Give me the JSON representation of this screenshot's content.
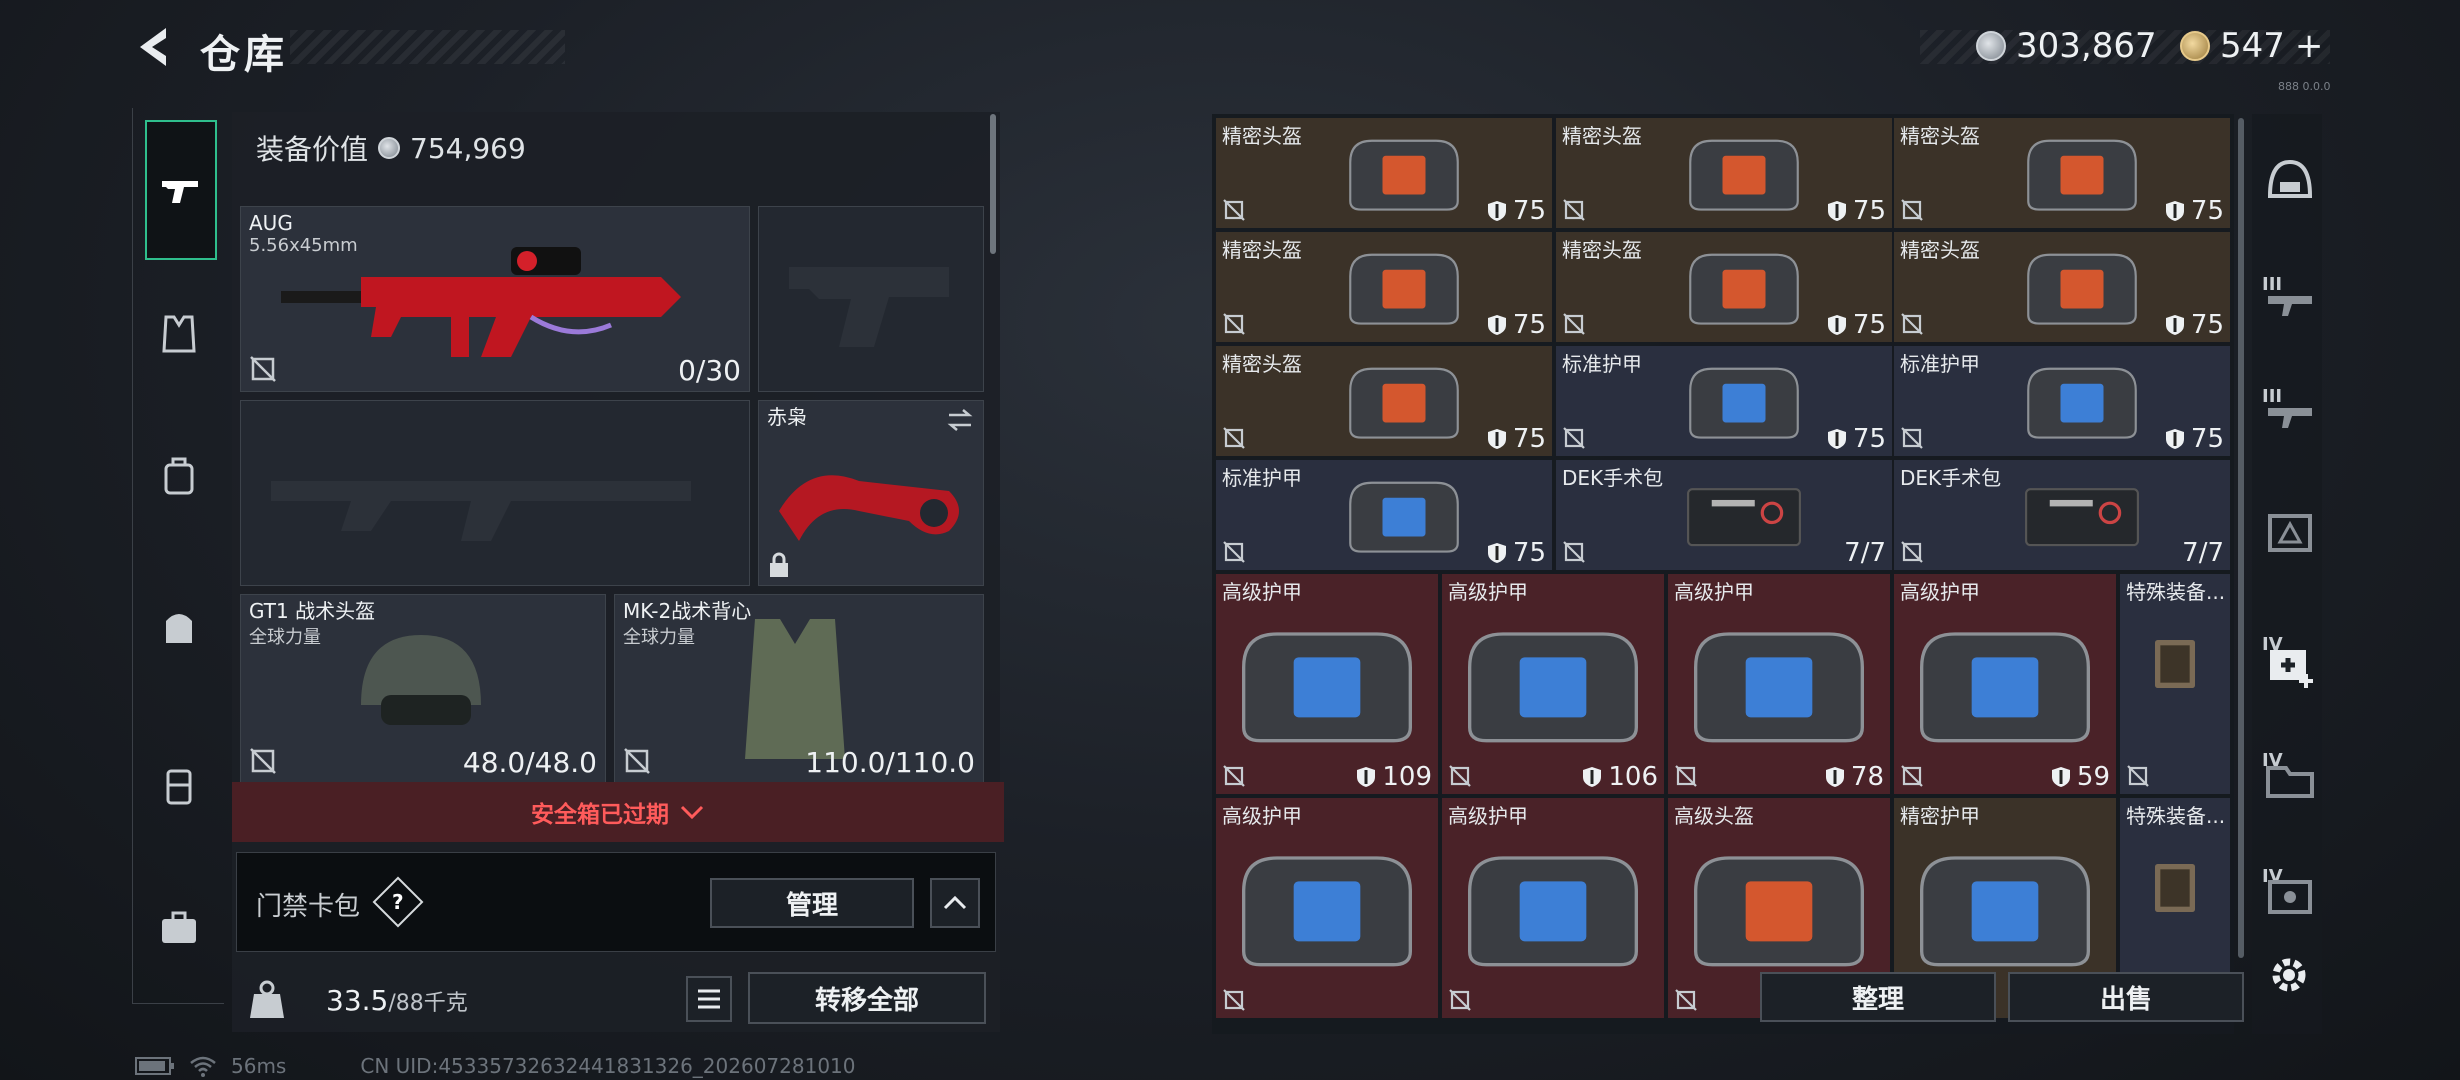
{
  "header": {
    "title": "仓库",
    "currency_silver": "303,867",
    "currency_gold": "547",
    "gold_plus": "+",
    "version": "888 0.0.0"
  },
  "equipment": {
    "value_label": "装备价值",
    "value": "754,969",
    "primary": {
      "name": "AUG",
      "ammo_type": "5.56x45mm",
      "ammo": "0/30"
    },
    "melee": {
      "name": "赤枭"
    },
    "helmet": {
      "name": "GT1 战术头盔",
      "brand": "全球力量",
      "durability": "48.0/48.0"
    },
    "vest": {
      "name": "MK-2战术背心",
      "brand": "全球力量",
      "durability": "110.0/110.0"
    },
    "safebox_status": "安全箱已过期",
    "keycard_label": "门禁卡包",
    "help_label": "?",
    "manage_label": "管理",
    "weight": "33.5",
    "weight_max": "/88千克",
    "transfer_all_label": "转移全部"
  },
  "storage": {
    "items": [
      {
        "name": "精密头盔",
        "val": "75",
        "type": "helmet",
        "bg": "brown"
      },
      {
        "name": "精密头盔",
        "val": "75",
        "type": "helmet",
        "bg": "brown"
      },
      {
        "name": "精密头盔",
        "val": "75",
        "type": "helmet",
        "bg": "brown"
      },
      {
        "name": "精密头盔",
        "val": "75",
        "type": "helmet",
        "bg": "brown"
      },
      {
        "name": "精密头盔",
        "val": "75",
        "type": "helmet",
        "bg": "brown"
      },
      {
        "name": "精密头盔",
        "val": "75",
        "type": "helmet",
        "bg": "brown"
      },
      {
        "name": "精密头盔",
        "val": "75",
        "type": "helmet",
        "bg": "brown"
      },
      {
        "name": "标准护甲",
        "val": "75",
        "type": "armor",
        "bg": "blue"
      },
      {
        "name": "标准护甲",
        "val": "75",
        "type": "armor",
        "bg": "blue"
      },
      {
        "name": "标准护甲",
        "val": "75",
        "type": "armor",
        "bg": "blue"
      },
      {
        "name": "DEK手术包",
        "val": "7/7",
        "type": "kit",
        "bg": "blue"
      },
      {
        "name": "DEK手术包",
        "val": "7/7",
        "type": "kit",
        "bg": "blue"
      },
      {
        "name": "高级护甲",
        "val": "109",
        "type": "armor",
        "bg": "red"
      },
      {
        "name": "高级护甲",
        "val": "106",
        "type": "armor",
        "bg": "red"
      },
      {
        "name": "高级护甲",
        "val": "78",
        "type": "armor",
        "bg": "red"
      },
      {
        "name": "高级护甲",
        "val": "59",
        "type": "armor",
        "bg": "red"
      },
      {
        "name": "特殊装备...",
        "val": "",
        "type": "special",
        "bg": "blue"
      },
      {
        "name": "高级护甲",
        "val": "",
        "type": "armor",
        "bg": "red"
      },
      {
        "name": "高级护甲",
        "val": "",
        "type": "armor",
        "bg": "red"
      },
      {
        "name": "高级头盔",
        "val": "",
        "type": "helmet",
        "bg": "red"
      },
      {
        "name": "精密护甲",
        "val": "",
        "type": "armor",
        "bg": "brown"
      },
      {
        "name": "特殊装备...",
        "val": "",
        "type": "special",
        "bg": "blue"
      }
    ],
    "sort_label": "整理",
    "sell_label": "出售"
  },
  "right_nav": {
    "tier_labels": [
      "III",
      "III",
      "IV",
      "IV",
      "IV"
    ]
  },
  "status": {
    "ping": "56ms",
    "uid": "CN UID:45335732632441831326_202607281010"
  },
  "colors": {
    "accent": "#2fbf8d",
    "expired": "#ff5b5b",
    "brown": "#3b3228",
    "blue": "#2a2f3f",
    "red": "#4a2228"
  }
}
